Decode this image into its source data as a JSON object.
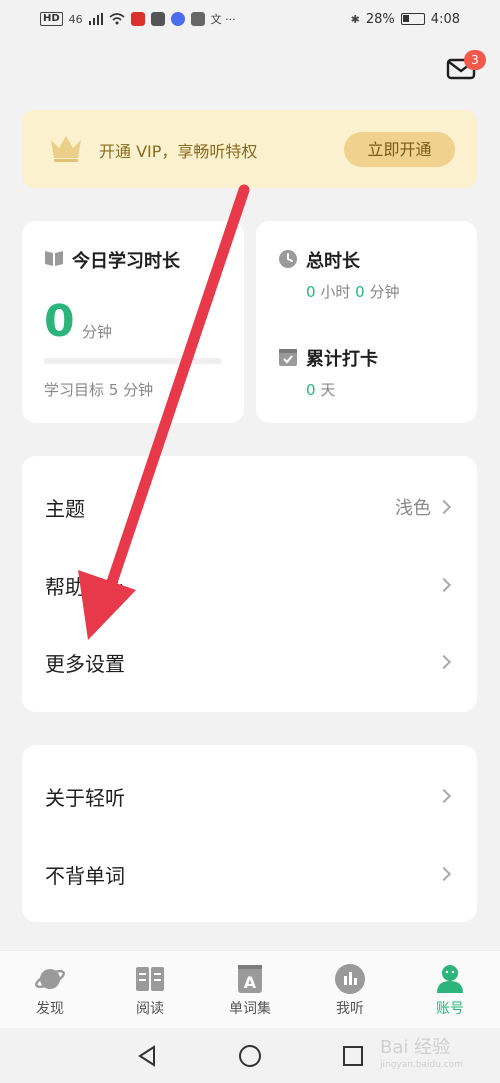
{
  "status_bar": {
    "network": "HD",
    "signal": "46",
    "battery": "28%",
    "time": "4:08"
  },
  "mail": {
    "badge": "3"
  },
  "vip": {
    "text": "开通 VIP，享畅听特权",
    "button": "立即开通"
  },
  "today": {
    "title": "今日学习时长",
    "minutes": "0",
    "unit": "分钟",
    "progress": 0,
    "goal": "学习目标 5 分钟"
  },
  "total": {
    "title": "总时长",
    "hours": "0",
    "hours_unit": "小时",
    "minutes": "0",
    "minutes_unit": "分钟",
    "checkin_title": "累计打卡",
    "days": "0",
    "days_unit": "天"
  },
  "settings": [
    {
      "label": "主题",
      "value": "浅色"
    },
    {
      "label": "帮助中心",
      "value": ""
    },
    {
      "label": "更多设置",
      "value": ""
    }
  ],
  "about": [
    {
      "label": "关于轻听"
    },
    {
      "label": "不背单词"
    }
  ],
  "nav": [
    {
      "label": "发现",
      "icon": "planet-icon"
    },
    {
      "label": "阅读",
      "icon": "book-icon"
    },
    {
      "label": "单词集",
      "icon": "word-set-icon"
    },
    {
      "label": "我听",
      "icon": "audio-bars-icon"
    },
    {
      "label": "账号",
      "icon": "account-icon",
      "active": true
    }
  ],
  "watermark": {
    "main": "Bai 经验",
    "sub": "jingyan.baidu.com"
  },
  "colors": {
    "accent": "#2cb57a",
    "vip_bg": "#fbf1cf",
    "vip_button": "#f0d28e",
    "badge": "#f15a4a",
    "annotation_arrow": "#e8394a"
  }
}
